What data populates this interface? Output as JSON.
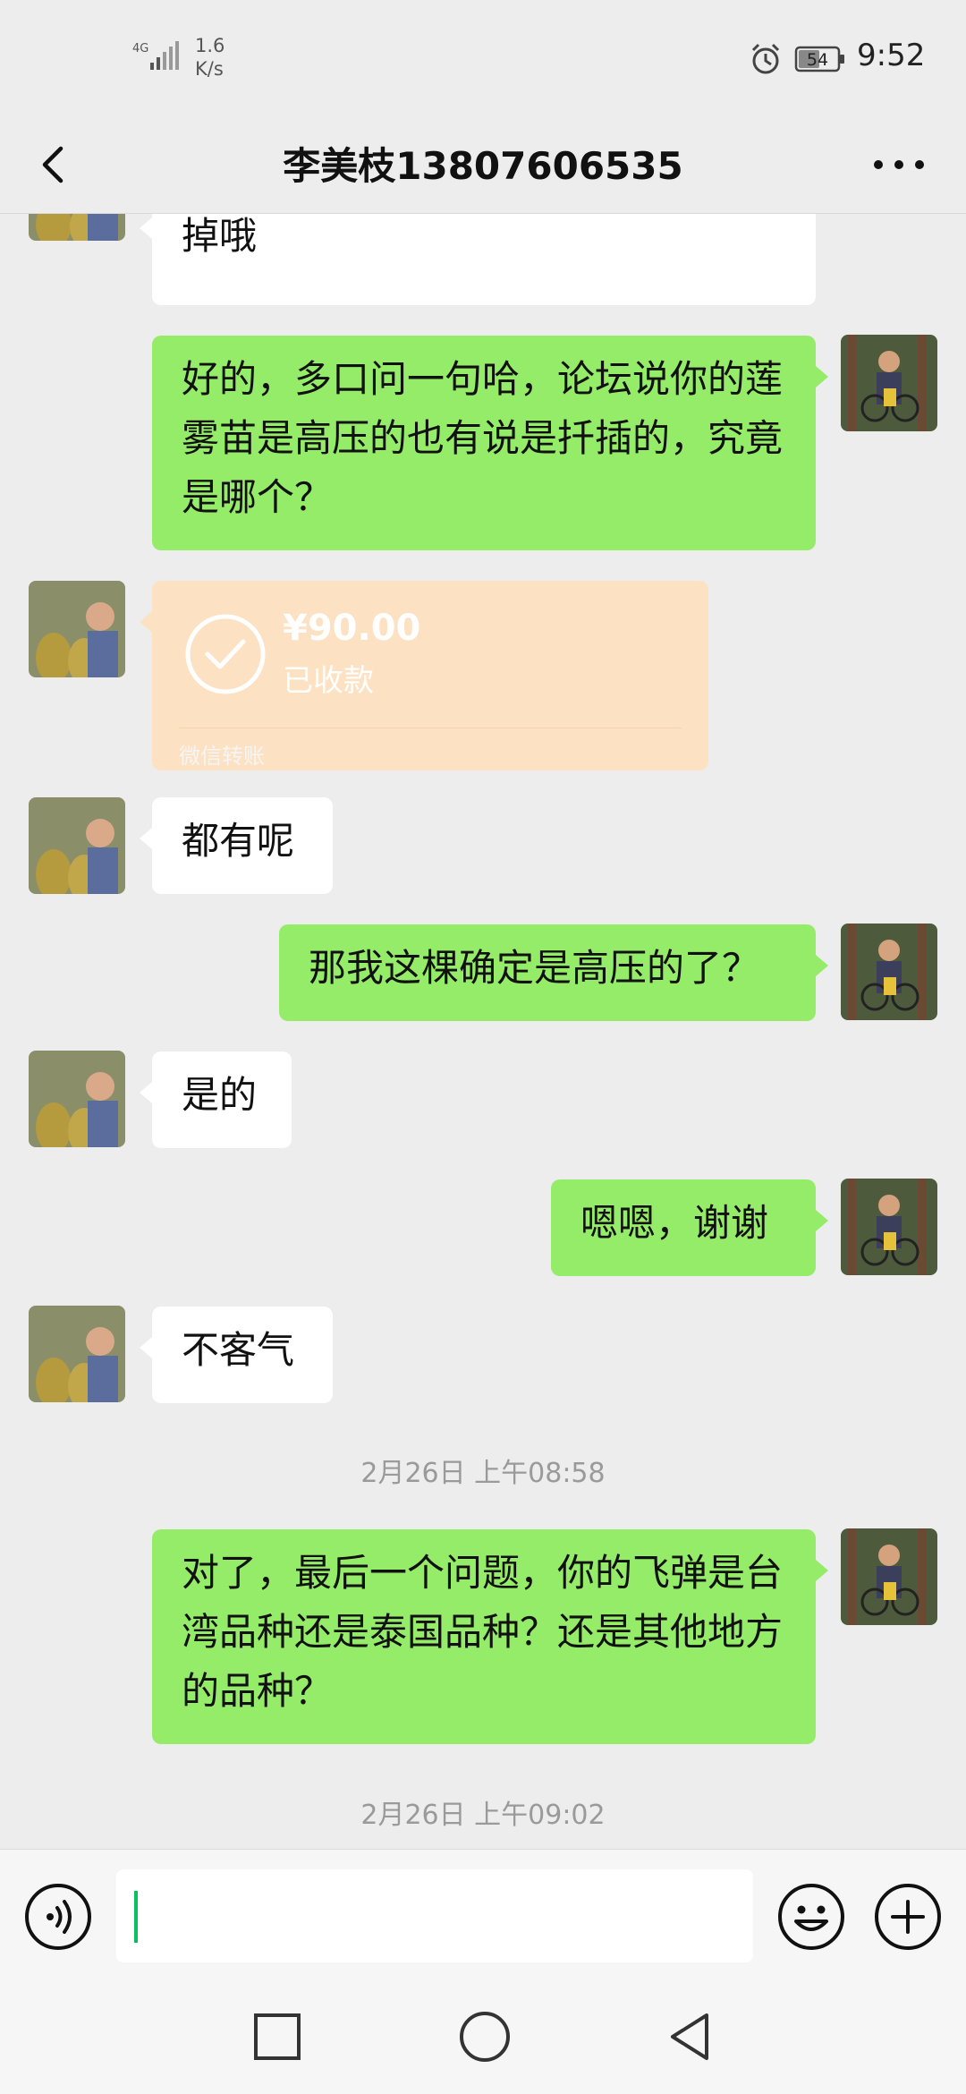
{
  "status_bar": {
    "network": "4G",
    "speed_value": "1.6",
    "speed_unit": "K/s",
    "battery": "54",
    "time": "9:52"
  },
  "header": {
    "title": "李美枝13807606535",
    "back_icon": "chevron-left-icon",
    "more_icon": "more-dots-icon"
  },
  "messages": [
    {
      "side": "in",
      "text": "掉哦"
    },
    {
      "side": "out",
      "text": "好的，多口问一句哈，论坛说你的莲雾苗是高压的也有说是扦插的，究竟是哪个？"
    },
    {
      "side": "in",
      "type": "transfer",
      "amount": "¥90.00",
      "status": "已收款",
      "label": "微信转账"
    },
    {
      "side": "in",
      "text": "都有呢"
    },
    {
      "side": "out",
      "text": "那我这棵确定是高压的了？"
    },
    {
      "side": "in",
      "text": "是的"
    },
    {
      "side": "out",
      "text": "嗯嗯，谢谢"
    },
    {
      "side": "in",
      "text": "不客气"
    },
    {
      "type": "time",
      "text": "2月26日 上午08:58"
    },
    {
      "side": "out",
      "text": "对了，最后一个问题，你的飞弹是台湾品种还是泰国品种？还是其他地方的品种？"
    },
    {
      "type": "time",
      "text": "2月26日 上午09:02"
    }
  ],
  "input_bar": {
    "voice_icon": "voice-icon",
    "emoji_icon": "emoji-icon",
    "plus_icon": "plus-icon"
  },
  "colors": {
    "background": "#ededed",
    "outgoing_bubble": "#95ec69",
    "incoming_bubble": "#ffffff",
    "transfer_card": "#fde1c3",
    "accent": "#07c160"
  }
}
